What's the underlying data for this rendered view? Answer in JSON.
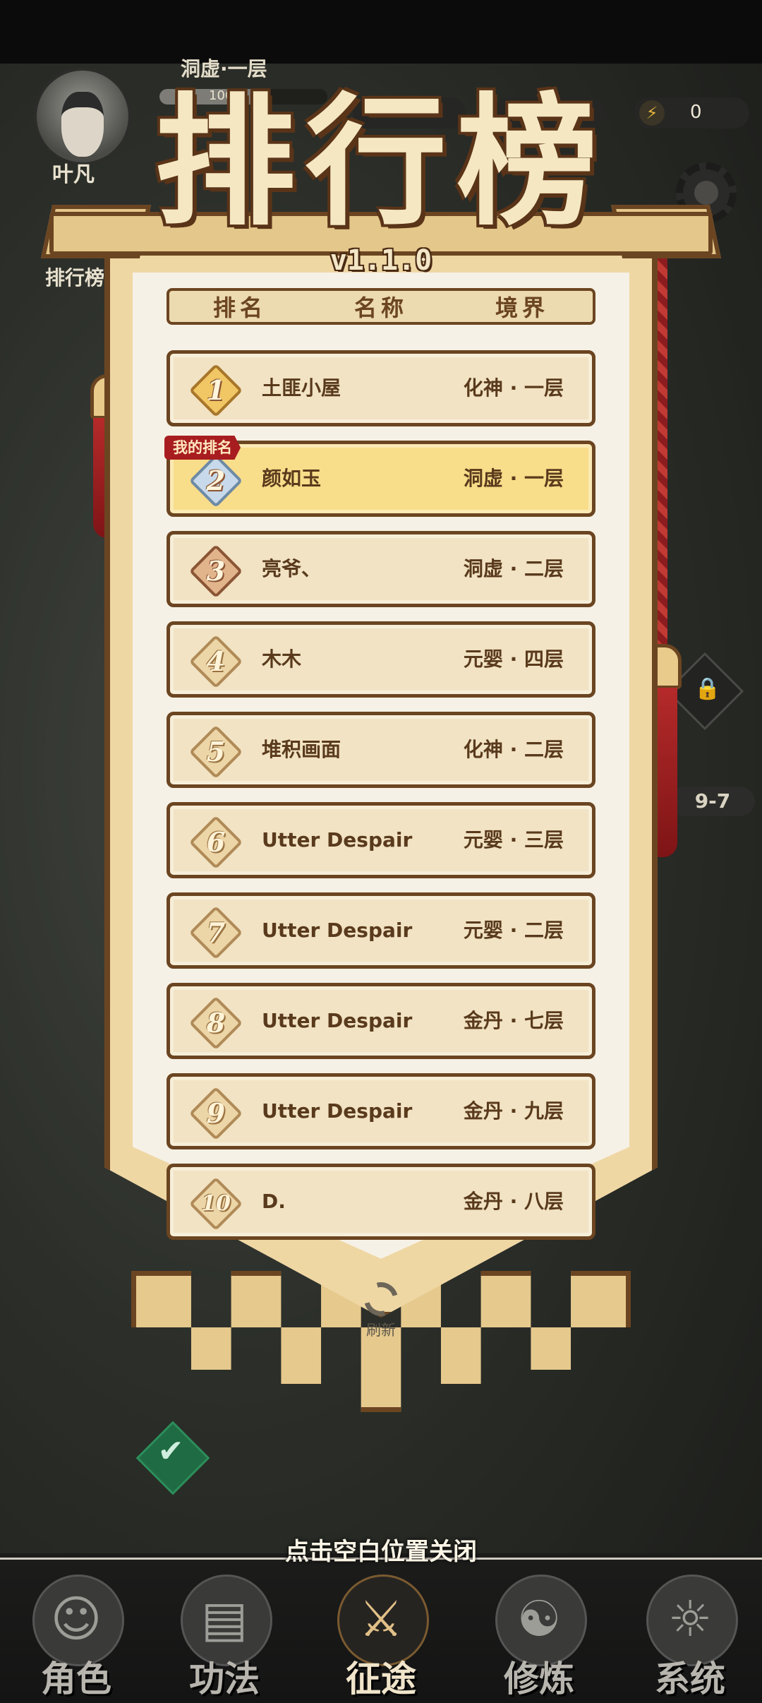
{
  "hud": {
    "player_name": "叶凡",
    "realm": "洞虚·一层",
    "exp_text": "1064/...5",
    "exp_progress": 0.55,
    "energy": "0",
    "rank_shortcut_label": "排行榜",
    "map_stage": "9-7"
  },
  "leaderboard": {
    "title": "排行榜",
    "version": "v1.1.0",
    "headers": [
      "排名",
      "名称",
      "境界"
    ],
    "my_rank_tag": "我的排名",
    "rows": [
      {
        "rank": "1",
        "name": "土匪小屋",
        "realm": "化神 · 一层",
        "tier": "gold"
      },
      {
        "rank": "2",
        "name": "颜如玉",
        "realm": "洞虚 · 一层",
        "tier": "silver",
        "mine": true
      },
      {
        "rank": "3",
        "name": "亮爷、",
        "realm": "洞虚 · 二层",
        "tier": "bronze"
      },
      {
        "rank": "4",
        "name": "木木",
        "realm": "元婴 · 四层",
        "tier": "plain"
      },
      {
        "rank": "5",
        "name": "堆积画面",
        "realm": "化神 · 二层",
        "tier": "plain"
      },
      {
        "rank": "6",
        "name": "Utter Despair",
        "realm": "元婴 · 三层",
        "tier": "plain"
      },
      {
        "rank": "7",
        "name": "Utter Despair",
        "realm": "元婴 · 二层",
        "tier": "plain"
      },
      {
        "rank": "8",
        "name": "Utter Despair",
        "realm": "金丹 · 七层",
        "tier": "plain"
      },
      {
        "rank": "9",
        "name": "Utter Despair",
        "realm": "金丹 · 九层",
        "tier": "plain"
      },
      {
        "rank": "10",
        "name": "D.",
        "realm": "金丹 · 八层",
        "tier": "plain"
      }
    ],
    "refresh_label": "刷新",
    "close_hint": "点击空白位置关闭"
  },
  "bottom_nav": {
    "items": [
      {
        "label": "角色",
        "icon": "character-icon"
      },
      {
        "label": "功法",
        "icon": "scroll-book-icon"
      },
      {
        "label": "征途",
        "icon": "sword-journey-icon",
        "active": true
      },
      {
        "label": "修炼",
        "icon": "meditation-icon"
      },
      {
        "label": "系统",
        "icon": "system-icon"
      }
    ]
  },
  "colors": {
    "banner_border": "#6b4521",
    "row_bg": "#f1e3c4",
    "my_row_bg": "#f8dd8a",
    "my_tag_red": "#a81d1f"
  }
}
